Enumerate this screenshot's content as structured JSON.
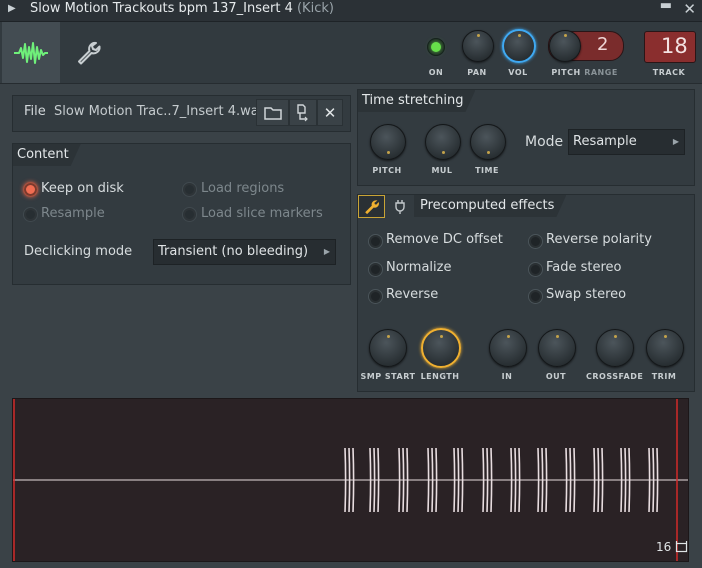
{
  "window": {
    "title": "Slow Motion Trackouts bpm 137_Insert 4",
    "subtitle": "(Kick)",
    "minimize_glyph": "▬",
    "close_glyph": "✕"
  },
  "toolbar": {
    "tabs": [
      {
        "icon": "waveform-icon",
        "active": true
      },
      {
        "icon": "wrench-icon",
        "active": false
      }
    ],
    "on_label": "ON",
    "pan_label": "PAN",
    "vol_label": "VOL",
    "pitch_label": "PITCH",
    "range_label": "RANGE",
    "range_value": "2",
    "track_label": "TRACK",
    "track_value": "18",
    "on_color": "#67e04a",
    "vol_ring_color": "#3fa9f2",
    "range_box_color": "#7a2c2c",
    "track_box_color": "#8a2e2e"
  },
  "file": {
    "label": "File",
    "name": "Slow Motion Trac..7_Insert 4.wav"
  },
  "content": {
    "title": "Content",
    "options": [
      {
        "label": "Keep on disk",
        "checked": true,
        "enabled": true
      },
      {
        "label": "Load regions",
        "checked": false,
        "enabled": false
      },
      {
        "label": "Resample",
        "checked": false,
        "enabled": false
      },
      {
        "label": "Load slice markers",
        "checked": false,
        "enabled": false
      }
    ],
    "declicking_label": "Declicking mode",
    "declicking_value": "Transient (no bleeding)"
  },
  "time_stretching": {
    "title": "Time stretching",
    "knobs": [
      "PITCH",
      "MUL",
      "TIME"
    ],
    "mode_label": "Mode",
    "mode_value": "Resample"
  },
  "precomputed": {
    "title": "Precomputed effects",
    "options": [
      {
        "label": "Remove DC offset"
      },
      {
        "label": "Reverse polarity"
      },
      {
        "label": "Normalize"
      },
      {
        "label": "Fade stereo"
      },
      {
        "label": "Reverse"
      },
      {
        "label": "Swap stereo"
      }
    ],
    "knobs": [
      "SMP START",
      "LENGTH",
      "IN",
      "OUT",
      "CROSSFADE",
      "TRIM"
    ],
    "length_ring_color": "#f0b030"
  },
  "waveform": {
    "snap_value": "16",
    "marker_color": "#d22a2a",
    "wave_color": "#e8dde0"
  }
}
